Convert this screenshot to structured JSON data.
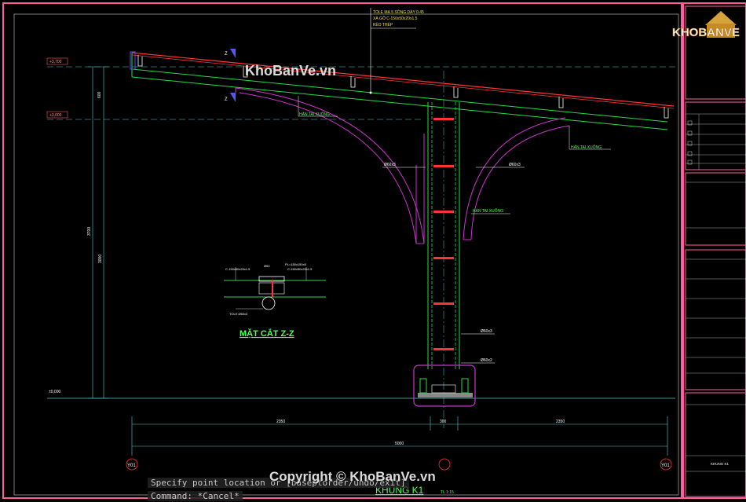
{
  "drawing": {
    "roof_note_1": "TOLE MẠ 5 SÓNG DÀY 0.45",
    "roof_note_2": "XÀ GỒ C-150x50x20x1.5",
    "roof_note_3": "KÈO THÉP",
    "level_top": "+3,700",
    "level_mid": "+3,000",
    "level_base": "±0,000",
    "weld_left": "HÀN TAI XUỐNG",
    "weld_right": "HÀN TAI XUỐNG",
    "weld_center": "HÀN TAI XUỐNG",
    "pipe_left": "Ø60x3",
    "pipe_right": "Ø60x3",
    "pipe_column_1": "Ø60x3",
    "pipe_column_2": "Ø60x2",
    "section_mark_top": "Z",
    "section_mark_bottom": "Z",
    "section_title": "MẶT CẮT Z-Z",
    "section_label_a": "C-150x50x20x1.5",
    "section_label_b": "C-150x50x20x1.5",
    "section_label_c": "Ø60",
    "section_label_d": "PL=150x150x5",
    "section_pipe_label": "TOLE Ø60x3",
    "dim_600": "600",
    "dim_3700": "3700",
    "dim_3000": "3000",
    "dim_left_span": "2350",
    "dim_center": "300",
    "dim_right_span": "2350",
    "dim_total": "5000",
    "grid_left": "Y01",
    "grid_center": "",
    "grid_right": "Y01",
    "frame_title": "KHUNG K1",
    "frame_scale": "TL 1:15"
  },
  "title_block": {
    "logo": "KHOBANVE",
    "drawing_name": "KHUNG K1"
  },
  "command_line": {
    "line1": "Specify point location or [baseptorder/undo/exit]",
    "line2": "Command: *Cancel*"
  },
  "watermarks": {
    "top": "KhoBanVe.vn",
    "bottom": "Copyright © KhoBanVe.vn"
  },
  "colors": {
    "background": "#000000",
    "frame_border": "#ff5fa0",
    "construction_green": "#22dd44",
    "rafter_red": "#ff3333",
    "bracket_magenta": "#cc33cc",
    "dimension_cyan": "#55cccc",
    "text_yellow": "#f0e040",
    "text_green": "#55ff55"
  }
}
